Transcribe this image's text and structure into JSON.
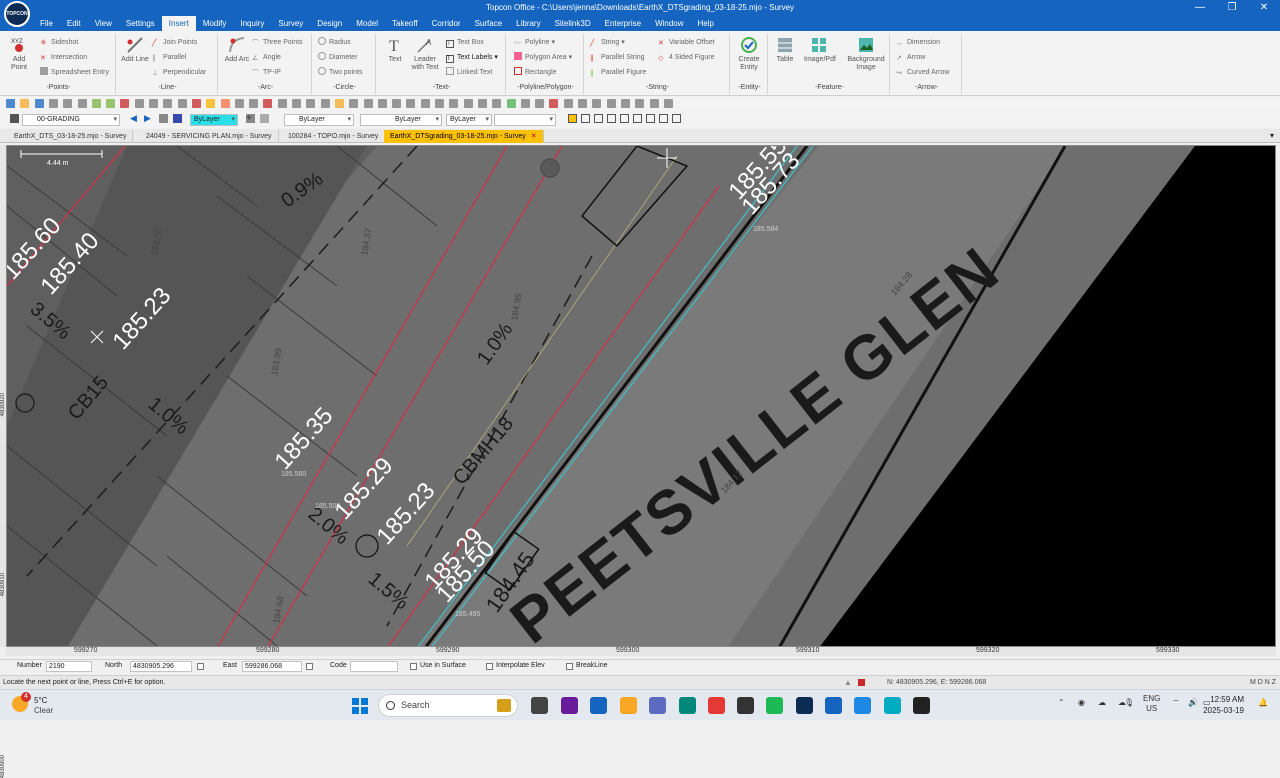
{
  "window": {
    "title": "Topcon Office - C:\\Users\\jenna\\Downloads\\EarthX_DTSgrading_03-18-25.mjo - Survey",
    "logo": "TOPCON",
    "minimize": "—",
    "restore": "❐",
    "close": "✕"
  },
  "menu": [
    "File",
    "Edit",
    "View",
    "Settings",
    "Insert",
    "Modify",
    "Inquiry",
    "Survey",
    "Design",
    "Model",
    "Takeoff",
    "Corridor",
    "Surface",
    "Library",
    "Sitelink3D",
    "Enterprise",
    "Window",
    "Help"
  ],
  "active_menu": "Insert",
  "ribbon": {
    "points": {
      "name": "-Points-",
      "big": "Add Point",
      "small": [
        "Sideshot",
        "Intersection",
        "Spreadsheet Entry"
      ]
    },
    "line": {
      "name": "-Line-",
      "big": "Add Line",
      "small": [
        "Join Points",
        "Parallel",
        "Perpendicular"
      ]
    },
    "arc": {
      "name": "-Arc-",
      "big": "Add Arc",
      "small": [
        "Three Points",
        "Angle",
        "TP-IP"
      ]
    },
    "circle": {
      "name": "-Circle-",
      "small": [
        "Radius",
        "Diameter",
        "Two points"
      ]
    },
    "text": {
      "name": "-Text-",
      "big": [
        "Text",
        "Leader with Text"
      ],
      "small": [
        "Text Box",
        "Text Labels",
        "Linked Text"
      ]
    },
    "polyline": {
      "name": "-Polyline/Polygon-",
      "small": [
        "Polyline",
        "Polygon Area",
        "Rectangle"
      ]
    },
    "string": {
      "name": "-String-",
      "small": [
        "String",
        "Parallel String",
        "Parallel Figure",
        "Variable Offset",
        "4 Sided Figure"
      ]
    },
    "entity": {
      "name": "-Entity-",
      "big": "Create Entity"
    },
    "feature": {
      "name": "-Feature-",
      "big": [
        "Table",
        "Image/Pdf",
        "Background Image"
      ]
    },
    "arrow": {
      "name": "-Arrow-",
      "small": [
        "Dimension",
        "Arrow",
        "Curved Arrow"
      ]
    }
  },
  "toolbar2": {
    "layer": "00-GRADING",
    "color": "ByLayer",
    "linetype_name": "ByLayer",
    "lineweight": "ByLayer",
    "style": "ByLayer",
    "extra": ""
  },
  "doc_tabs": [
    {
      "label": "EarthX_DTS_03-18-25.mjo - Survey",
      "active": false
    },
    {
      "label": "24049 - SERVICING PLAN.mjo - Survey",
      "active": false
    },
    {
      "label": "100284 - TOPO.mjo - Survey",
      "active": false
    },
    {
      "label": "EarthX_DTSgrading_03-18-25.mjo - Survey",
      "active": true
    }
  ],
  "doc_tab_close": "✕",
  "canvas": {
    "scale_label": "4.44 m",
    "labels_big": [
      "185.60",
      "185.40",
      "185.23",
      "185.35",
      "185.29",
      "185.23",
      "185.29",
      "185.50",
      "185.55",
      "185.73",
      "184.45"
    ],
    "labels_grade": [
      "0.9%",
      "1.0%",
      "1.0%",
      "1.5%",
      "2.0%",
      "3.5%"
    ],
    "labels_structures": [
      "CB15",
      "CBMH18"
    ],
    "street_name": "PEETSVILLE GLEN",
    "small_elev": [
      "184.28",
      "184.12",
      "184.37",
      "183.76",
      "183.99",
      "184.68",
      "184.95",
      "185.584",
      "185.560",
      "185.500",
      "185.495"
    ],
    "left_ticks": [
      "4830920",
      "4830910",
      "4830900"
    ],
    "bottom_ticks": [
      "599270",
      "599280",
      "599290",
      "599300",
      "599310",
      "599320",
      "599330"
    ]
  },
  "inputbar": {
    "number_label": "Number",
    "number_value": "2190",
    "north_label": "North",
    "north_value": "4830905.296",
    "east_label": "East",
    "east_value": "599286.068",
    "code_label": "Code",
    "code_value": "",
    "use_in_surface": "Use in Surface",
    "interpolate_elev": "Interpolate Elev",
    "breakline": "BreakLine"
  },
  "status": {
    "message": "Locate the next point or line, Press Ctrl+E for option.",
    "coords": "N: 4830905.296, E: 599286.068",
    "mode": "M D N Z"
  },
  "taskbar": {
    "weather_temp": "5°C",
    "weather_desc": "Clear",
    "badge": "4",
    "search": "Search",
    "lang": "ENG",
    "region": "US",
    "time": "12:59 AM",
    "date": "2025-03-19"
  },
  "colors": {
    "accent": "#1565c0",
    "active_tab": "#ffc107",
    "curb": "#c0394f",
    "edge": "#3ec1c9",
    "surface": "#6e6e6e"
  }
}
